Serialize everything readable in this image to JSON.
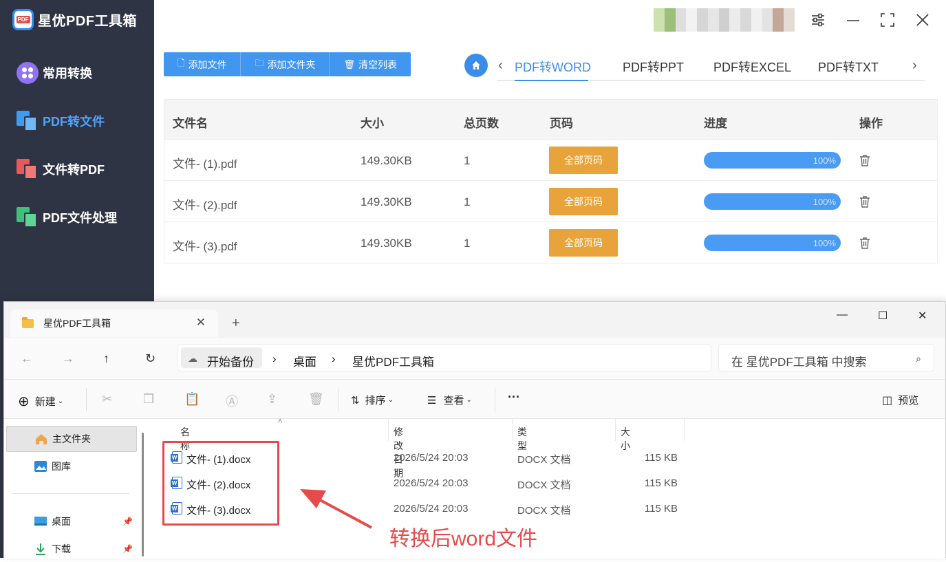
{
  "app": {
    "title": "星优PDF工具箱",
    "logo_badge": "PDF",
    "accent": "#3d8ee8",
    "sidebar": [
      {
        "label": "常用转换",
        "icon": "grid-circle-icon",
        "active": false
      },
      {
        "label": "PDF转文件",
        "icon": "pdf-to-file-icon",
        "active": true
      },
      {
        "label": "文件转PDF",
        "icon": "file-to-pdf-icon",
        "active": false
      },
      {
        "label": "PDF文件处理",
        "icon": "pdf-process-icon",
        "active": false
      }
    ],
    "toolbar": {
      "add_file": "添加文件",
      "add_folder": "添加文件夹",
      "clear_list": "清空列表"
    },
    "tabs": [
      {
        "label": "PDF转WORD",
        "active": true
      },
      {
        "label": "PDF转PPT",
        "active": false
      },
      {
        "label": "PDF转EXCEL",
        "active": false
      },
      {
        "label": "PDF转TXT",
        "active": false
      }
    ],
    "table": {
      "headers": {
        "name": "文件名",
        "size": "大小",
        "pages": "总页数",
        "page_range": "页码",
        "progress": "进度",
        "action": "操作"
      },
      "rows": [
        {
          "name": "文件- (1).pdf",
          "size": "149.30KB",
          "pages": "1",
          "page_btn": "全部页码",
          "progress": "100%"
        },
        {
          "name": "文件- (2).pdf",
          "size": "149.30KB",
          "pages": "1",
          "page_btn": "全部页码",
          "progress": "100%"
        },
        {
          "name": "文件- (3).pdf",
          "size": "149.30KB",
          "pages": "1",
          "page_btn": "全部页码",
          "progress": "100%"
        }
      ]
    },
    "window_controls": {
      "settings": "⚙",
      "minimize": "—",
      "maximize": "⛶",
      "close": "✕"
    }
  },
  "explorer": {
    "tab_title": "星优PDF工具箱",
    "breadcrumb": [
      "开始备份",
      "桌面",
      "星优PDF工具箱"
    ],
    "search_placeholder": "在 星优PDF工具箱 中搜索",
    "commands": {
      "new": "新建",
      "sort": "排序",
      "view": "查看",
      "more": "···",
      "preview": "预览"
    },
    "sidebar": [
      {
        "label": "主文件夹",
        "icon": "home-icon",
        "selected": true
      },
      {
        "label": "图库",
        "icon": "gallery-icon",
        "selected": false
      },
      {
        "label": "桌面",
        "icon": "desktop-icon",
        "selected": false,
        "pinned": true
      },
      {
        "label": "下载",
        "icon": "download-icon",
        "selected": false,
        "pinned": true
      }
    ],
    "columns": {
      "name": "名称",
      "date": "修改日期",
      "type": "类型",
      "size": "大小"
    },
    "files": [
      {
        "name": "文件- (1).docx",
        "date": "2026/5/24 20:03",
        "type": "DOCX 文档",
        "size": "115 KB"
      },
      {
        "name": "文件- (2).docx",
        "date": "2026/5/24 20:03",
        "type": "DOCX 文档",
        "size": "115 KB"
      },
      {
        "name": "文件- (3).docx",
        "date": "2026/5/24 20:03",
        "type": "DOCX 文档",
        "size": "115 KB"
      }
    ]
  },
  "annotation": {
    "text": "转换后word文件",
    "color": "#e74a4a"
  }
}
